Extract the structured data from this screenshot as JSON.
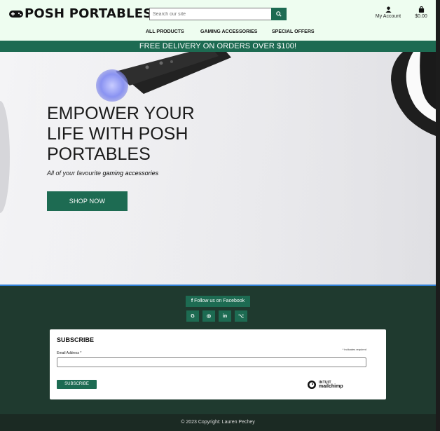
{
  "header": {
    "logo_text": "POSH PORTABLES",
    "search_placeholder": "Search our site",
    "account_label": "My Account",
    "bag_total": "$0.00"
  },
  "nav": {
    "items": [
      "ALL PRODUCTS",
      "GAMING ACCESSORIES",
      "SPECIAL OFFERS"
    ]
  },
  "banner": {
    "text": "FREE DELIVERY ON ORDERS OVER $100!"
  },
  "hero": {
    "title_line1": "EMPOWER YOUR",
    "title_line2_a": "LIFE WITH ",
    "title_line2_b": "POSH",
    "title_line3": "PORTABLES",
    "subtitle_a": "All of your favourite ",
    "subtitle_b": "gaming accessories",
    "cta": "SHOP NOW"
  },
  "footer": {
    "facebook_label": "Follow us on Facebook",
    "social_icons": [
      "G",
      "◎",
      "in",
      "⌥"
    ],
    "subscribe_heading": "SUBSCRIBE",
    "required_note": "* indicates required",
    "email_label": "Email Address *",
    "subscribe_button": "SUBSCRIBE",
    "mailchimp_line1": "INTUIT",
    "mailchimp_line2": "mailchimp",
    "copyright": "© 2023 Copyright: Lauren Pechey"
  },
  "colors": {
    "brand_green": "#1d6b52",
    "header_bg": "#eefdf0",
    "footer_bg": "#1f3a2f"
  }
}
